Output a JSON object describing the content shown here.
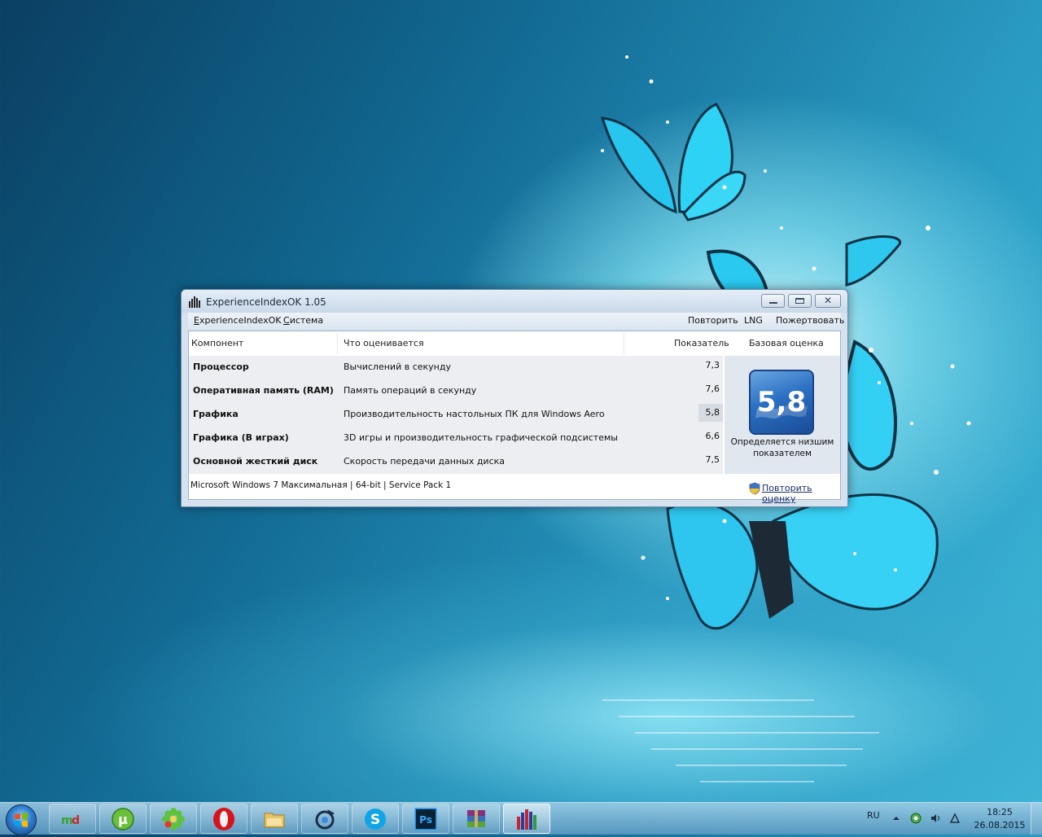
{
  "window": {
    "title": "ExperienceIndexOK 1.05",
    "close_glyph": "✕"
  },
  "menu": {
    "left": [
      "ExperienceIndexOK",
      "Система"
    ],
    "right": [
      "Повторить",
      "LNG",
      "Пожертвовать"
    ]
  },
  "table": {
    "headers": {
      "component": "Компонент",
      "rated": "Что оценивается",
      "score": "Показатель",
      "base": "Базовая оценка"
    },
    "rows": [
      {
        "component": "Процессор",
        "rated": "Вычислений в секунду",
        "score": "7,3"
      },
      {
        "component": "Оперативная память (RAM)",
        "rated": "Память операций в секунду",
        "score": "7,6"
      },
      {
        "component": "Графика",
        "rated": "Производительность настольных ПК для Windows Aero",
        "score": "5,8"
      },
      {
        "component": "Графика (В играх)",
        "rated": "3D игры и производительность графической подсистемы",
        "score": "6,6"
      },
      {
        "component": "Основной жесткий диск",
        "rated": "Скорость передачи данных диска",
        "score": "7,5"
      }
    ]
  },
  "base_score": {
    "value": "5,8",
    "caption_line1": "Определяется низшим",
    "caption_line2": "показателем"
  },
  "footer": {
    "os_info": "Microsoft Windows 7 Максимальная | 64-bit | Service Pack 1",
    "rerun_link": "Повторить оценку"
  },
  "taskbar": {
    "buttons": [
      "mydocs-icon",
      "utorrent-icon",
      "icq-icon",
      "opera-icon",
      "explorer-icon",
      "player-icon",
      "skype-icon",
      "photoshop-icon",
      "winrar-icon",
      "experienceindex-icon"
    ],
    "tray": {
      "lang": "RU",
      "time": "18:25",
      "date": "26.08.2015"
    }
  },
  "colors": {
    "accent": "#2a6fc2",
    "window_frame": "#d6e3ef"
  }
}
